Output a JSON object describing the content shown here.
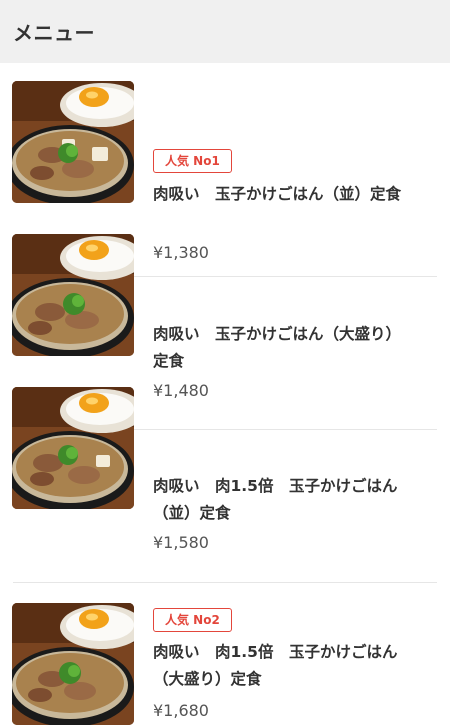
{
  "header": {
    "title": "メニュー"
  },
  "menu": {
    "items": [
      {
        "badge": "人気 No1",
        "name": "肉吸い　玉子かけごはん（並）定食",
        "price": "¥1,380"
      },
      {
        "badge": "",
        "name": "肉吸い　玉子かけごはん（大盛り）定食",
        "price": "¥1,480"
      },
      {
        "badge": "",
        "name": "肉吸い　肉1.5倍　玉子かけごはん（並）定食",
        "price": "¥1,580"
      },
      {
        "badge": "人気 No2",
        "name": "肉吸い　肉1.5倍　玉子かけごはん（大盛り）定食",
        "price": "¥1,680"
      }
    ]
  },
  "colors": {
    "badge": "#e3463b",
    "header_bg": "#f0f0f0",
    "divider": "#e6e6e6"
  },
  "icons": {
    "thumbnail": "food-photo"
  }
}
